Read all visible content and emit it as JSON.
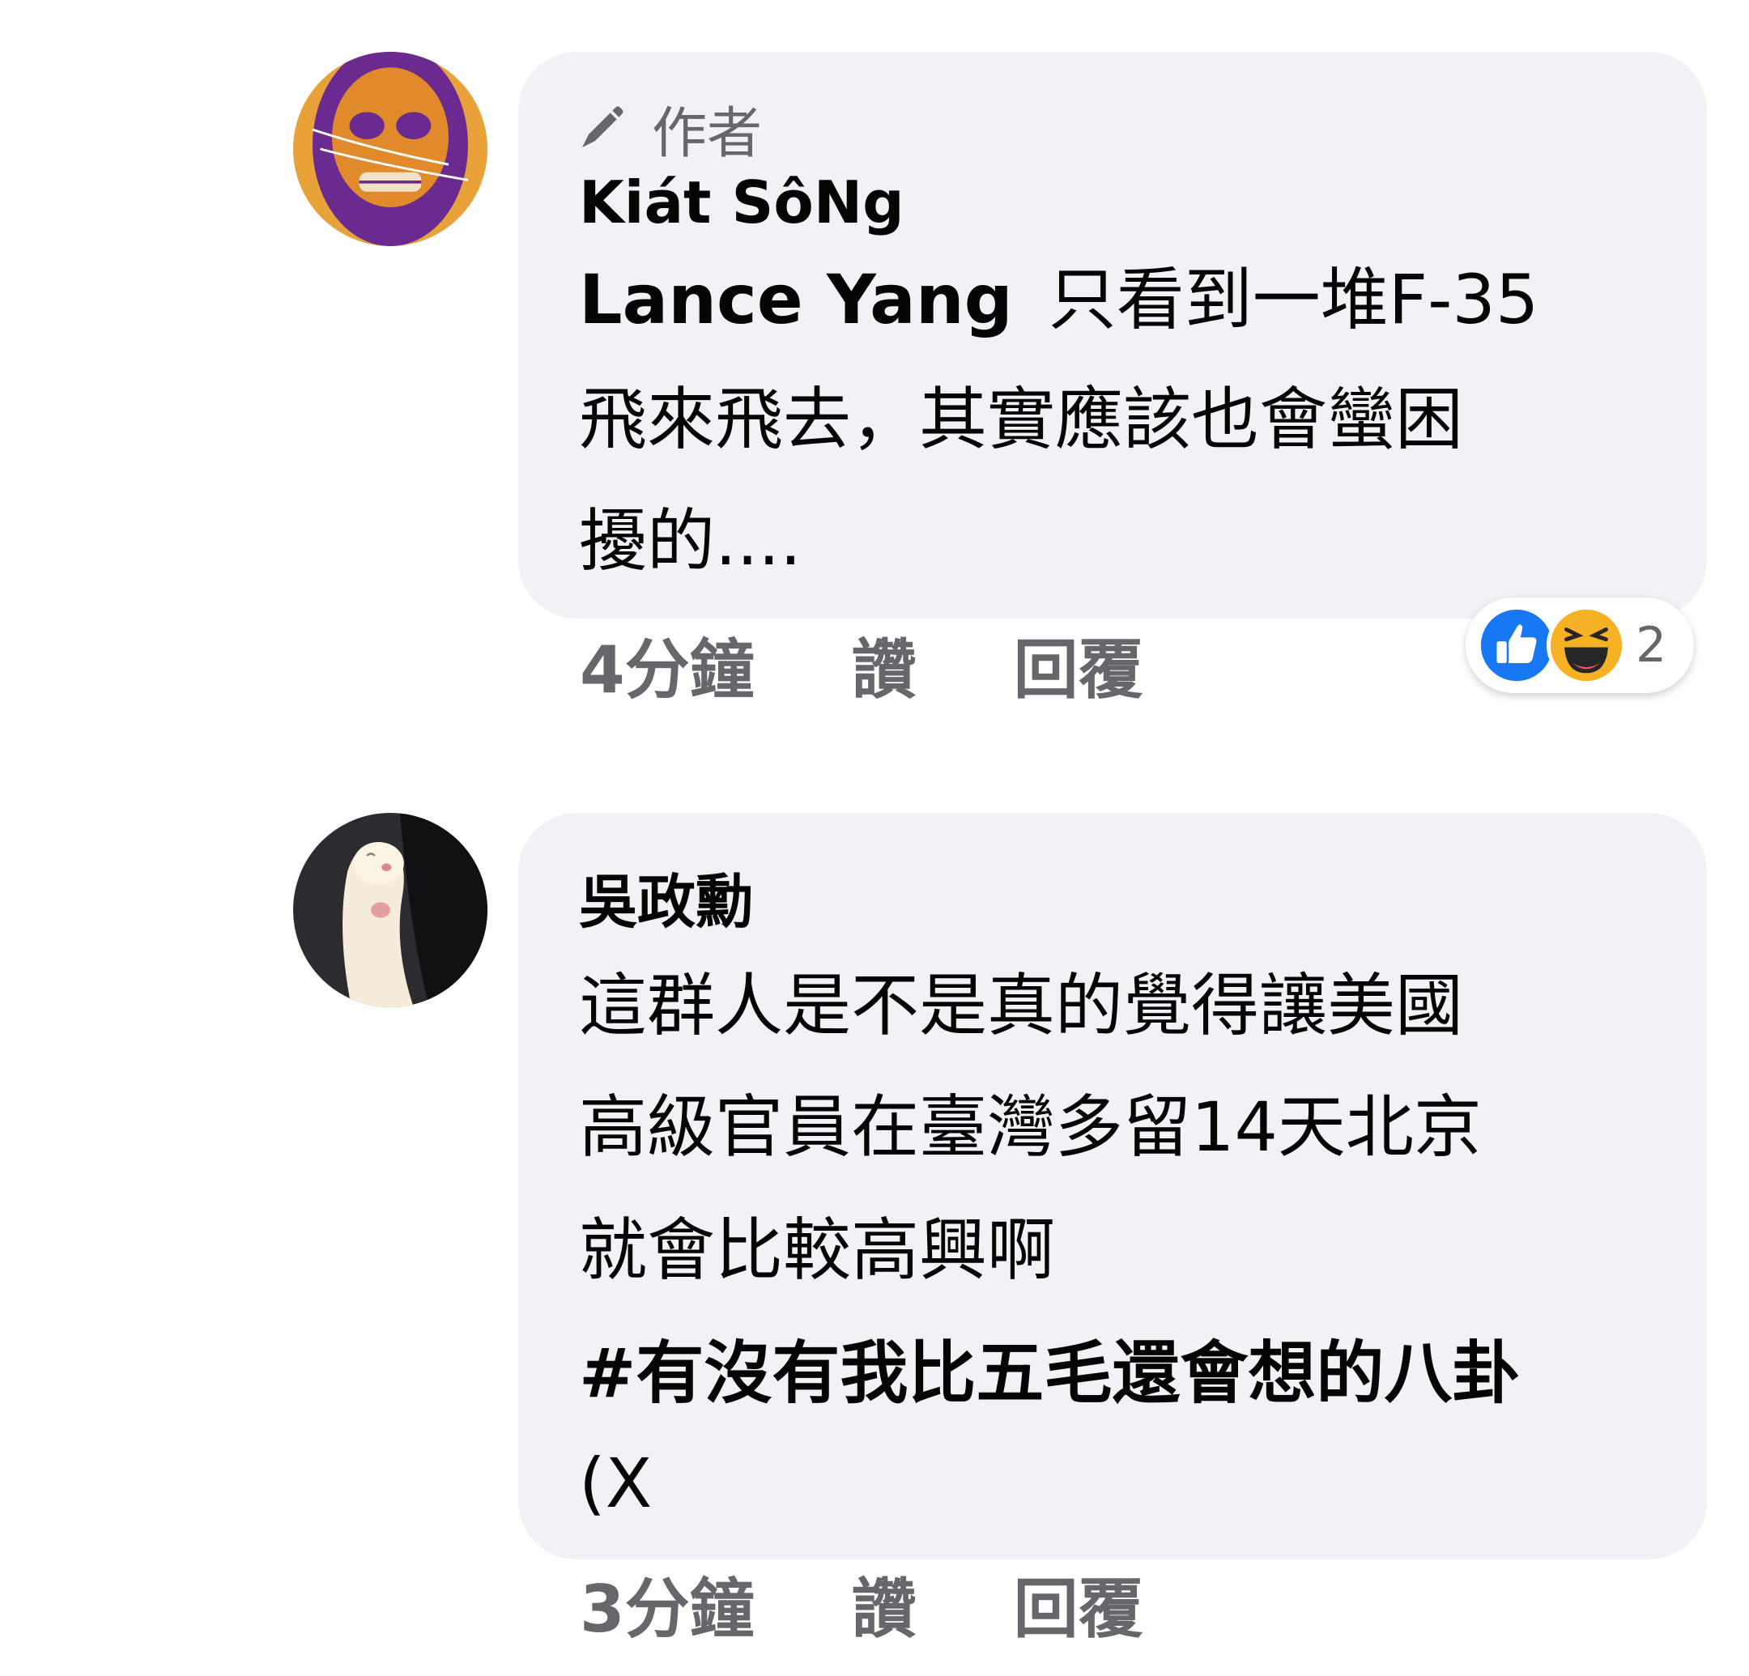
{
  "comments": [
    {
      "author_badge": "作者",
      "author": "Kiát SôNg",
      "mention": "Lance Yang",
      "lines": [
        "只看到一堆F-35",
        "飛來飛去，其實應該也會蠻困",
        "擾的...."
      ],
      "time": "4分鐘",
      "like_label": "讚",
      "reply_label": "回覆",
      "reactions": {
        "icons": [
          "like-icon",
          "haha-icon"
        ],
        "count": "2"
      }
    },
    {
      "author": "吳政勳",
      "lines": [
        "這群人是不是真的覺得讓美國",
        "高級官員在臺灣多留14天北京",
        "就會比較高興啊"
      ],
      "hashtag_lines": [
        "#有沒有我比五毛還會想的八卦",
        "(X"
      ],
      "time": "3分鐘",
      "like_label": "讚",
      "reply_label": "回覆"
    }
  ],
  "colors": {
    "bubble": "#f0f2f5",
    "secondary_text": "#65676b",
    "like_blue": "#1877f2",
    "haha_yellow": "#f7b125"
  }
}
